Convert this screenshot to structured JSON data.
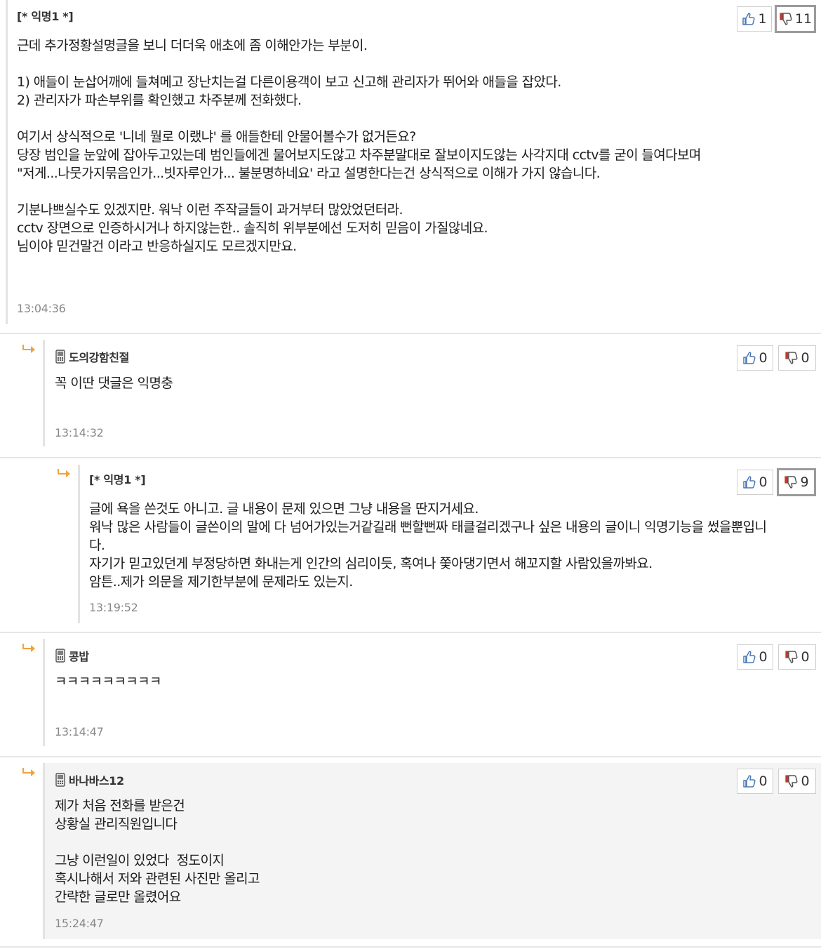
{
  "comments": [
    {
      "author": "[* 익명1 *]",
      "text": "근데 추가정황설명글을 보니 더더욱 애초에 좀 이해안가는 부분이.\n\n1) 애들이 눈삽어깨에 들쳐메고 장난치는걸 다른이용객이 보고 신고해 관리자가 뛰어와 애들을 잡았다.\n2) 관리자가 파손부위를 확인했고 차주분께 전화했다.\n\n여기서 상식적으로 '니네 뭘로 이랬냐' 를 애들한테 안물어볼수가 없거든요?\n당장 범인을 눈앞에 잡아두고있는데 범인들에겐 물어보지도않고 차주분말대로 잘보이지도않는 사각지대 cctv를 굳이 들여다보며\n\"저게...나뭇가지묶음인가...빗자루인가... 불분명하네요' 라고 설명한다는건 상식적으로 이해가 가지 않습니다.\n\n기분나쁘실수도 있겠지만. 워낙 이런 주작글들이 과거부터 많았었던터라.\ncctv 장면으로 인증하시거나 하지않는한.. 솔직히 위부분에선 도저히 믿음이 가질않네요.\n님이야 믿건말건 이라고 반응하실지도 모르겠지만요.",
      "time": "13:04:36",
      "up": "1",
      "down": "11"
    },
    {
      "author": "도의강함친절",
      "text": "꼭 이딴 댓글은 익명충",
      "time": "13:14:32",
      "up": "0",
      "down": "0"
    },
    {
      "author": "[* 익명1 *]",
      "text": "글에 욕을 쓴것도 아니고. 글 내용이 문제 있으면 그냥 내용을 딴지거세요.\n워낙 많은 사람들이 글쓴이의 말에 다 넘어가있는거같길래 뻔할뻔짜 태클걸리겠구나 싶은 내용의 글이니 익명기능을 썼을뿐입니\n다.\n자기가 믿고있던게 부정당하면 화내는게 인간의 심리이듯, 혹여나 쫓아댕기면서 해꼬지할 사람있을까봐요.\n암튼..제가 의문을 제기한부분에 문제라도 있는지.",
      "time": "13:19:52",
      "up": "0",
      "down": "9"
    },
    {
      "author": "콩밥",
      "text": "ㅋㅋㅋㅋㅋㅋㅋㅋㅋ",
      "time": "13:14:47",
      "up": "0",
      "down": "0"
    },
    {
      "author": "바나바스12",
      "text": "제가 처음 전화를 받은건\n상황실 관리직원입니다\n\n그냥 이런일이 있었다  정도이지\n혹시나해서 저와 관련된 사진만 올리고\n간략한 글로만 올렸어요",
      "time": "15:24:47",
      "up": "0",
      "down": "0"
    }
  ],
  "colors": {
    "reply_arrow": "#f2a23a",
    "like_icon": "#4a78b5",
    "dislike_icon": "#c0392b",
    "highlight_bg": "#f4f4f4"
  }
}
